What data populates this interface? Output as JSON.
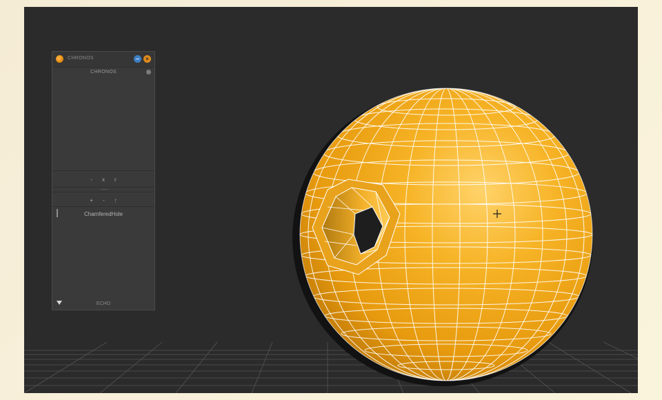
{
  "panel": {
    "window_title": "CHRONOS",
    "header_label": "CHRONOS",
    "history_tools": [
      "-",
      "x",
      "r"
    ],
    "list_tools": [
      "+",
      "-",
      "↑"
    ],
    "items": [
      {
        "label": "ChamferedHole"
      }
    ],
    "footer_label": "ECHO"
  },
  "colors": {
    "sphere": "#f0a818",
    "wireframe": "#ffffff",
    "viewport_bg": "#2b2b2b",
    "panel_bg": "#3a3a3a",
    "close_button": "#e08a1c",
    "minimize_button": "#3d7fc4"
  },
  "icons": {
    "logo": "chronos-logo-icon",
    "minimize": "minimize-icon",
    "close": "close-icon",
    "status": "status-dot-icon",
    "footer": "triangle-down-icon",
    "cursor": "move-cursor-icon"
  }
}
